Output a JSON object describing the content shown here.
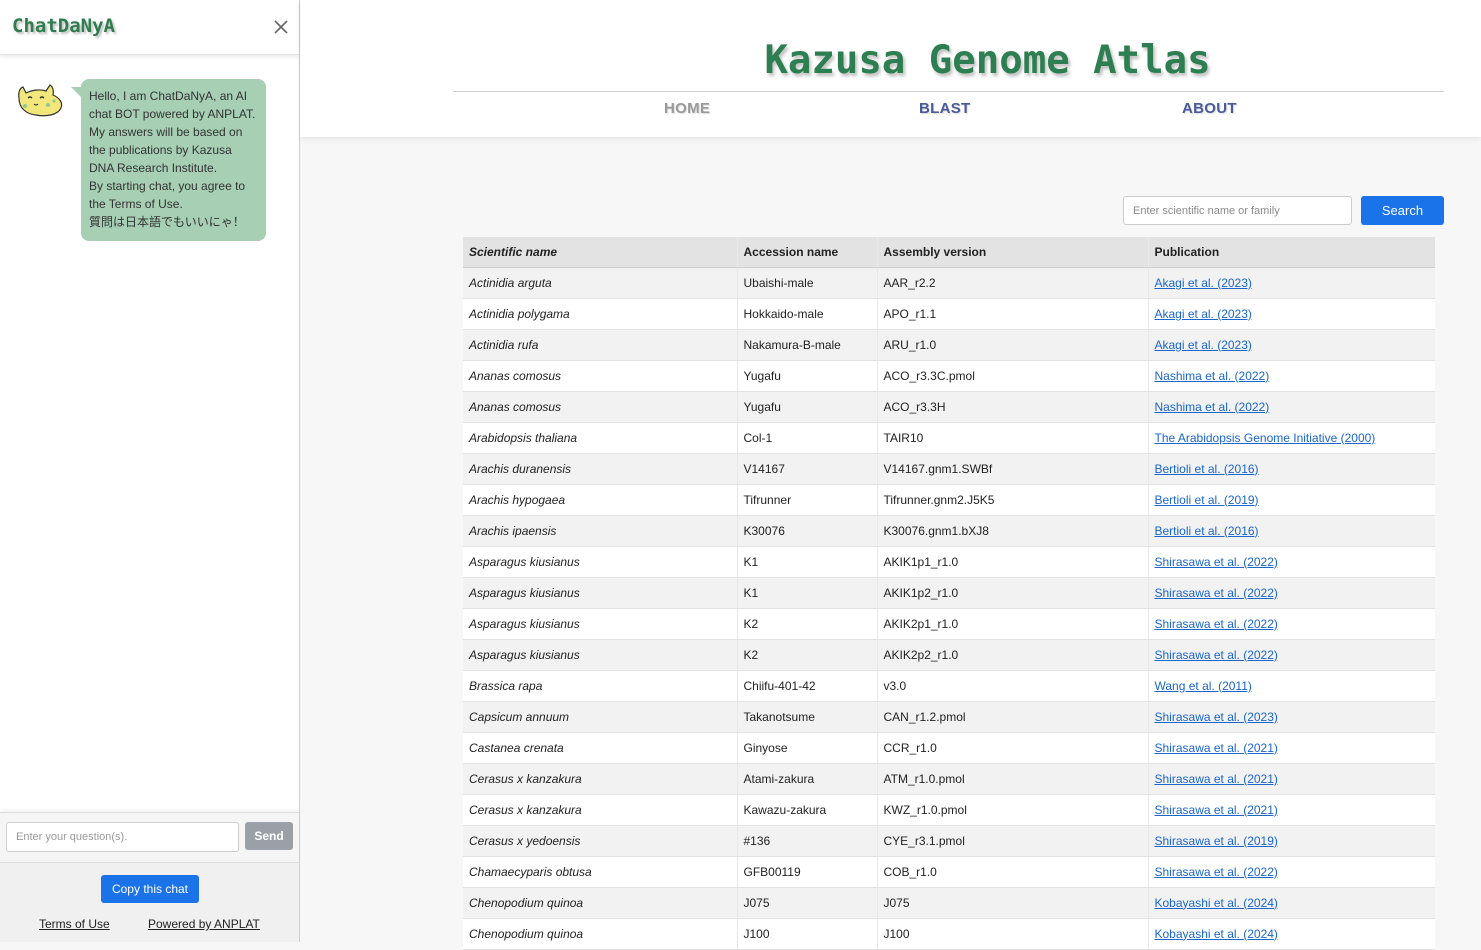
{
  "chat": {
    "title": "ChatDaNyA",
    "messages": [
      {
        "sender": "bot",
        "text": "Hello, I am ChatDaNyA, an AI chat BOT powered by ANPLAT. My answers will be based on the publications by Kazusa DNA Research Institute.\nBy starting chat, you agree to the Terms of Use.\n質問は日本語でもいいにゃ！"
      }
    ],
    "input_placeholder": "Enter your question(s).",
    "send_label": "Send",
    "copy_label": "Copy this chat",
    "terms_label": "Terms of Use",
    "powered_label": "Powered by ANPLAT",
    "colors": {
      "title": "#2f7d4f",
      "bubble": "#a6cfb4",
      "send": "#9aa0a6",
      "copy": "#1a73e8"
    }
  },
  "site": {
    "title": "Kazusa Genome Atlas",
    "nav": [
      {
        "label": "HOME"
      },
      {
        "label": "BLAST"
      },
      {
        "label": "ABOUT"
      }
    ],
    "search": {
      "placeholder": "Enter scientific name or family",
      "button_label": "Search"
    },
    "colors": {
      "title": "#2d7e50",
      "nav": "#4a5a9a",
      "link": "#1a66cc",
      "button": "#1a73e8"
    }
  },
  "table": {
    "headers": [
      "Scientific name",
      "Accession name",
      "Assembly version",
      "Publication"
    ],
    "rows": [
      [
        "Actinidia arguta",
        "Ubaishi-male",
        "AAR_r2.2",
        "Akagi et al. (2023)"
      ],
      [
        "Actinidia polygama",
        "Hokkaido-male",
        "APO_r1.1",
        "Akagi et al. (2023)"
      ],
      [
        "Actinidia rufa",
        "Nakamura-B-male",
        "ARU_r1.0",
        "Akagi et al. (2023)"
      ],
      [
        "Ananas comosus",
        "Yugafu",
        "ACO_r3.3C.pmol",
        "Nashima et al. (2022)"
      ],
      [
        "Ananas comosus",
        "Yugafu",
        "ACO_r3.3H",
        "Nashima et al. (2022)"
      ],
      [
        "Arabidopsis thaliana",
        "Col-1",
        "TAIR10",
        "The Arabidopsis Genome Initiative (2000)"
      ],
      [
        "Arachis duranensis",
        "V14167",
        "V14167.gnm1.SWBf",
        "Bertioli et al. (2016)"
      ],
      [
        "Arachis hypogaea",
        "Tifrunner",
        "Tifrunner.gnm2.J5K5",
        "Bertioli et al. (2019)"
      ],
      [
        "Arachis ipaensis",
        "K30076",
        "K30076.gnm1.bXJ8",
        "Bertioli et al. (2016)"
      ],
      [
        "Asparagus kiusianus",
        "K1",
        "AKIK1p1_r1.0",
        "Shirasawa et al. (2022)"
      ],
      [
        "Asparagus kiusianus",
        "K1",
        "AKIK1p2_r1.0",
        "Shirasawa et al. (2022)"
      ],
      [
        "Asparagus kiusianus",
        "K2",
        "AKIK2p1_r1.0",
        "Shirasawa et al. (2022)"
      ],
      [
        "Asparagus kiusianus",
        "K2",
        "AKIK2p2_r1.0",
        "Shirasawa et al. (2022)"
      ],
      [
        "Brassica rapa",
        "Chiifu-401-42",
        "v3.0",
        "Wang et al. (2011)"
      ],
      [
        "Capsicum annuum",
        "Takanotsume",
        "CAN_r1.2.pmol",
        "Shirasawa et al. (2023)"
      ],
      [
        "Castanea crenata",
        "Ginyose",
        "CCR_r1.0",
        "Shirasawa et al. (2021)"
      ],
      [
        "Cerasus x kanzakura",
        "Atami-zakura",
        "ATM_r1.0.pmol",
        "Shirasawa et al. (2021)"
      ],
      [
        "Cerasus x kanzakura",
        "Kawazu-zakura",
        "KWZ_r1.0.pmol",
        "Shirasawa et al. (2021)"
      ],
      [
        "Cerasus x yedoensis",
        "#136",
        "CYE_r3.1.pmol",
        "Shirasawa et al. (2019)"
      ],
      [
        "Chamaecyparis obtusa",
        "GFB00119",
        "COB_r1.0",
        "Shirasawa et al. (2022)"
      ],
      [
        "Chenopodium quinoa",
        "J075",
        "J075",
        "Kobayashi et al. (2024)"
      ],
      [
        "Chenopodium quinoa",
        "J100",
        "J100",
        "Kobayashi et al. (2024)"
      ]
    ]
  }
}
